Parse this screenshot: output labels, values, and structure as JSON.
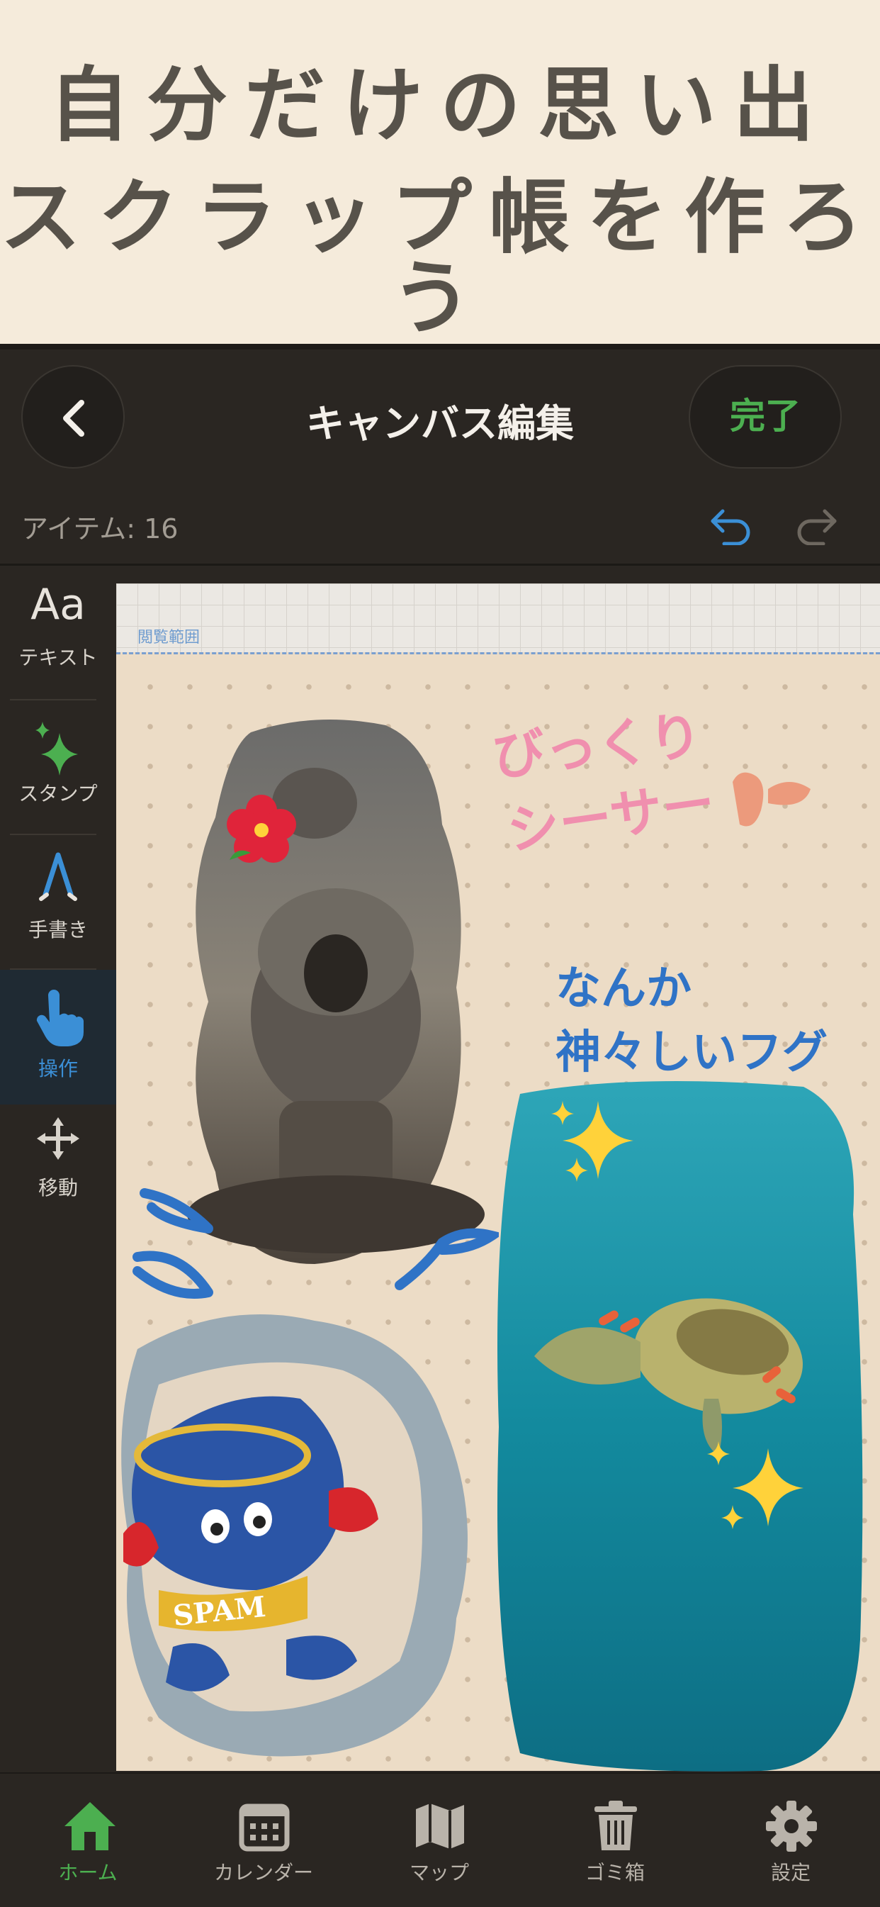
{
  "promo": {
    "line1": "自分だけの思い出",
    "line2": "スクラップ帳を作ろう"
  },
  "header": {
    "title": "キャンバス編集",
    "done_label": "完了"
  },
  "subbar": {
    "item_count": "アイテム: 16"
  },
  "tools": [
    {
      "label": "テキスト",
      "glyph": "Aa",
      "icon": "text-icon"
    },
    {
      "label": "スタンプ",
      "icon": "sparkle-icon"
    },
    {
      "label": "手書き",
      "icon": "pen-icon"
    },
    {
      "label": "操作",
      "icon": "tap-hand-icon",
      "active": true
    },
    {
      "label": "移動",
      "icon": "move-arrows-icon"
    }
  ],
  "canvas": {
    "range_label": "閲覧範囲",
    "handwriting": {
      "pink_line1": "びっくり",
      "pink_line2": "シーサー",
      "blue_line1": "なんか",
      "blue_line2": "神々しいフグ"
    },
    "photos": [
      "shisa-photo",
      "spam-mascot-photo",
      "pufferfish-photo"
    ],
    "plush_text": "SPAM"
  },
  "tabs": [
    {
      "label": "ホーム",
      "icon": "home-icon",
      "active": true
    },
    {
      "label": "カレンダー",
      "icon": "calendar-icon"
    },
    {
      "label": "マップ",
      "icon": "map-icon"
    },
    {
      "label": "ゴミ箱",
      "icon": "trash-icon"
    },
    {
      "label": "設定",
      "icon": "gear-icon"
    }
  ],
  "colors": {
    "accent_green": "#4caf50",
    "accent_blue": "#3b8fd6",
    "handwriting_pink": "#f08fae",
    "handwriting_blue": "#2f73c6"
  }
}
